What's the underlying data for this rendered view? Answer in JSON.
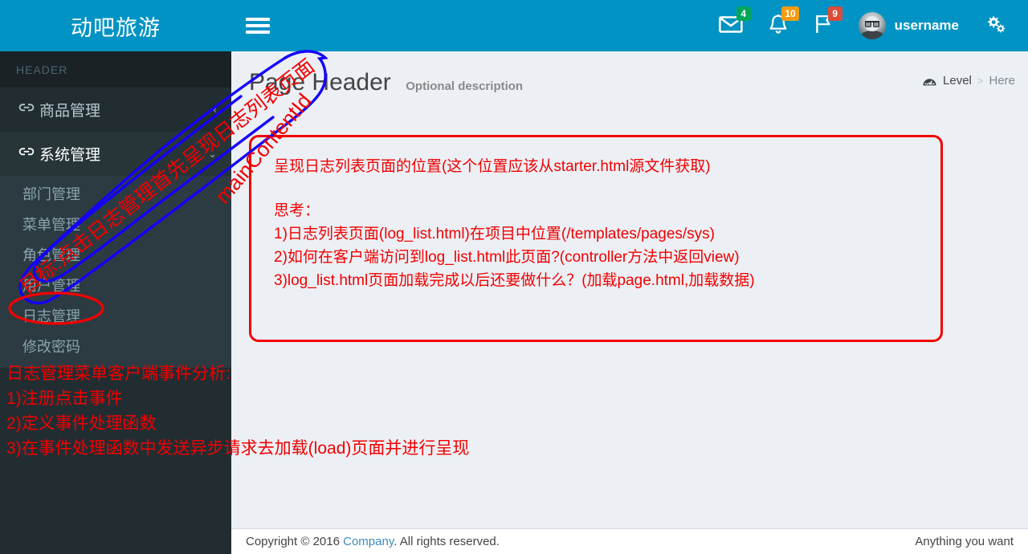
{
  "navbar": {
    "logo_text": "动吧旅游",
    "menu_toggle_name": "toggle-navigation",
    "icons": [
      {
        "name": "envelope-icon",
        "glyph": "✉",
        "badge": "4",
        "badge_color": "#00a65a"
      },
      {
        "name": "bell-icon",
        "glyph": "🔔",
        "badge": "10",
        "badge_color": "#f39c12"
      },
      {
        "name": "flag-icon",
        "glyph": "⚑",
        "badge": "9",
        "badge_color": "#dd4b39"
      }
    ],
    "username": "username",
    "settings_icon": "gears-icon",
    "bg_color": "#0093c4"
  },
  "sidebar": {
    "header_label": "HEADER",
    "items": [
      {
        "label": "商品管理",
        "icon": "link-icon",
        "arrow": "‹",
        "active": false
      },
      {
        "label": "系统管理",
        "icon": "link-icon",
        "arrow": "⌄",
        "active": true
      }
    ],
    "submenu": [
      {
        "label": "部门管理"
      },
      {
        "label": "菜单管理"
      },
      {
        "label": "角色管理"
      },
      {
        "label": "用户管理"
      },
      {
        "label": "日志管理",
        "highlighted": true
      },
      {
        "label": "修改密码"
      }
    ],
    "bg_color": "#222d32",
    "submenu_bg_color": "#2c3b41"
  },
  "content": {
    "page_title": "Page Header",
    "page_description": "Optional description",
    "breadcrumb": {
      "icon": "dashboard-icon",
      "level_label": "Level",
      "separator": ">",
      "here_label": "Here"
    }
  },
  "annotations": {
    "box_lines": [
      "呈现日志列表页面的位置(这个位置应该从starter.html源文件获取)",
      "思考：",
      "1)日志列表页面(log_list.html)在项目中位置(/templates/pages/sys)",
      "2)如何在客户端访问到log_list.html此页面?(controller方法中返回view)",
      "3)log_list.html页面加载完成以后还要做什么？(加载page.html,加载数据)"
    ],
    "note_lines": [
      "日志管理菜单客户端事件分析:",
      "1)注册点击事件",
      "2)定义事件处理函数",
      "3)在事件处理函数中发送异步请求去加载(load)页面并进行呈现"
    ],
    "rotated_goal": "目标:点击日志管理首先呈现日志列表页面",
    "rotated_id": "mainContentId",
    "ink_red": "#f20000",
    "ink_blue": "#1400ff"
  },
  "footer": {
    "copyright_prefix": "Copyright © 2016 ",
    "company_link": "Company",
    "copyright_suffix": ". All rights reserved.",
    "right_text": "Anything you want"
  }
}
